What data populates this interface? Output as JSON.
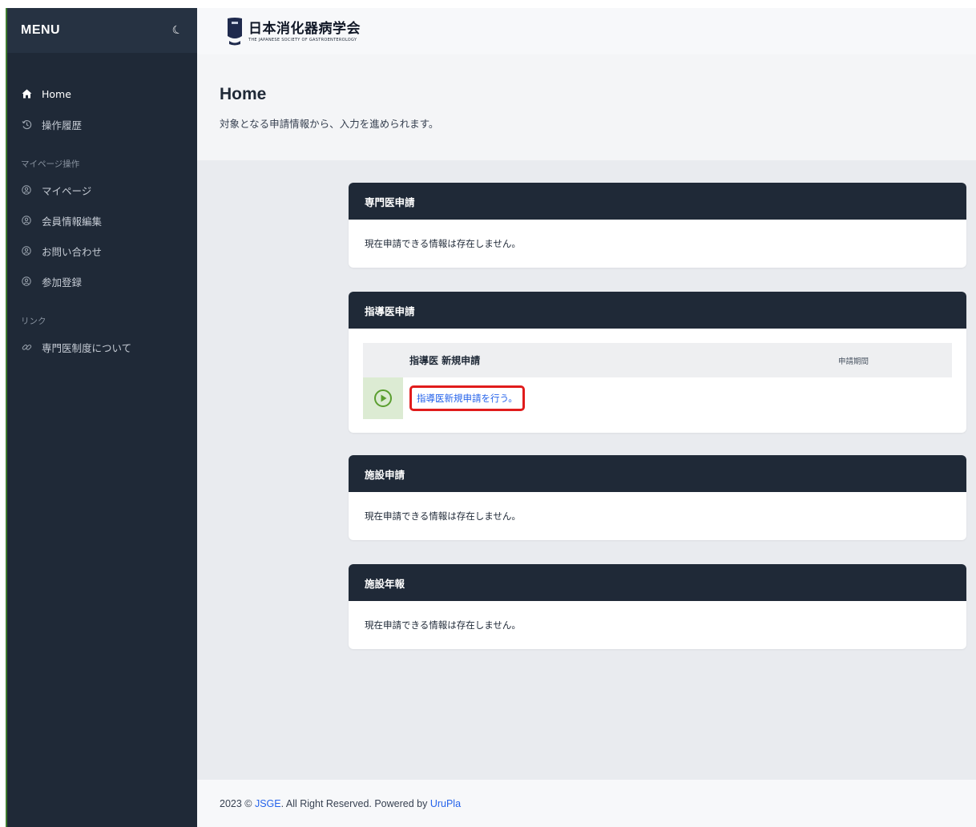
{
  "sidebar": {
    "title": "MENU",
    "theme_toggle_icon": "moon-icon",
    "items_main": [
      {
        "label": "Home",
        "icon": "home-icon"
      },
      {
        "label": "操作履歴",
        "icon": "history-icon"
      }
    ],
    "section_mypage": "マイページ操作",
    "items_mypage": [
      {
        "label": "マイページ",
        "icon": "circle-user-icon"
      },
      {
        "label": "会員情報編集",
        "icon": "circle-user-icon"
      },
      {
        "label": "お問い合わせ",
        "icon": "circle-user-icon"
      },
      {
        "label": "参加登録",
        "icon": "circle-user-icon"
      }
    ],
    "section_links": "リンク",
    "items_links": [
      {
        "label": "専門医制度について",
        "icon": "link-icon"
      }
    ]
  },
  "header": {
    "logo_jp": "日本消化器病学会",
    "logo_en": "THE JAPANESE SOCIETY OF GASTROENTEROLOGY"
  },
  "page": {
    "title": "Home",
    "subtitle": "対象となる申請情報から、入力を進められます。"
  },
  "cards": {
    "specialist": {
      "title": "専門医申請",
      "empty": "現在申請できる情報は存在しません。"
    },
    "instructor": {
      "title": "指導医申請",
      "table_header": "指導医 新規申請",
      "period_label": "申請期間",
      "action_icon": "play-circle-icon",
      "action_link": "指導医新規申請を行う。"
    },
    "facility": {
      "title": "施設申請",
      "empty": "現在申請できる情報は存在しません。"
    },
    "annual": {
      "title": "施設年報",
      "empty": "現在申請できる情報は存在しません。"
    }
  },
  "footer": {
    "prefix": "2023 © ",
    "org": "JSGE",
    "middle": ". All Right Reserved. Powered by ",
    "powered": "UruPla"
  },
  "colors": {
    "sidebar_bg": "#1f2937",
    "card_header_bg": "#1f2937",
    "link": "#2563eb",
    "highlight_border": "#e01c1c",
    "play_green": "#5a9e2f"
  }
}
